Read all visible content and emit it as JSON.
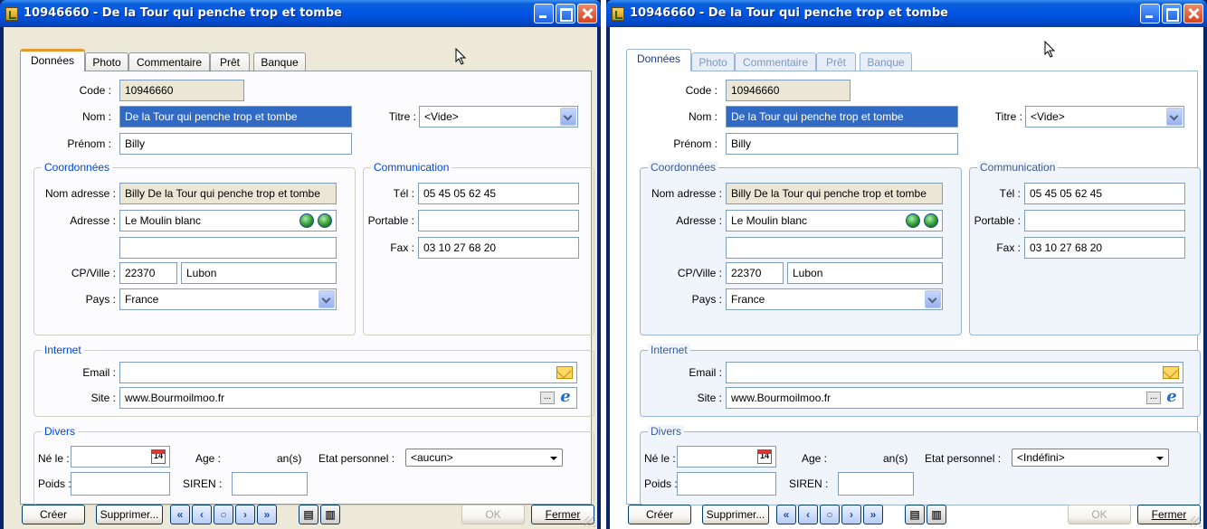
{
  "windows": [
    {
      "id": "left",
      "title": "10946660 - De la Tour qui penche trop et tombe",
      "tabs": [
        "Données",
        "Photo",
        "Commentaire",
        "Prêt",
        "Banque"
      ],
      "fields": {
        "code_label": "Code :",
        "code_value": "10946660",
        "nom_label": "Nom :",
        "nom_value": "De la Tour qui penche trop et tombe",
        "titre_label": "Titre :",
        "titre_value": "<Vide>",
        "prenom_label": "Prénom :",
        "prenom_value": "Billy"
      },
      "coordonnees": {
        "title": "Coordonnées",
        "nom_adresse_label": "Nom adresse :",
        "nom_adresse_value": "Billy De la Tour qui penche trop et tombe",
        "adresse_label": "Adresse :",
        "adresse_value": "Le Moulin blanc",
        "adresse2_value": "",
        "cpville_label": "CP/Ville :",
        "cp_value": "22370",
        "ville_value": "Lubon",
        "pays_label": "Pays :",
        "pays_value": "France"
      },
      "communication": {
        "title": "Communication",
        "tel_label": "Tél :",
        "tel_value": "05 45 05 62 45",
        "portable_label": "Portable :",
        "portable_value": "",
        "fax_label": "Fax :",
        "fax_value": "03 10 27 68 20"
      },
      "internet": {
        "title": "Internet",
        "email_label": "Email :",
        "email_value": "",
        "site_label": "Site :",
        "site_value": "www.Bourmoilmoo.fr",
        "dots": "..."
      },
      "divers": {
        "title": "Divers",
        "ne_le_label": "Né le :",
        "ne_le_value": "",
        "age_label": "Age :",
        "ans_label": "an(s)",
        "etat_label": "Etat personnel :",
        "etat_value": "<aucun>",
        "poids_label": "Poids :",
        "poids_value": "",
        "siren_label": "SIREN :",
        "siren_value": "",
        "calendar_day": "14"
      },
      "buttons": {
        "creer": "Créer",
        "supprimer": "Supprimer...",
        "ok": "OK",
        "fermer": "Fermer"
      }
    },
    {
      "id": "right",
      "title": "10946660 - De la Tour qui penche trop et tombe",
      "tabs": [
        "Données",
        "Photo",
        "Commentaire",
        "Prêt",
        "Banque"
      ],
      "fields": {
        "code_label": "Code :",
        "code_value": "10946660",
        "nom_label": "Nom :",
        "nom_value": "De la Tour qui penche trop et tombe",
        "titre_label": "Titre :",
        "titre_value": "<Vide>",
        "prenom_label": "Prénom :",
        "prenom_value": "Billy"
      },
      "coordonnees": {
        "title": "Coordonnées",
        "nom_adresse_label": "Nom adresse :",
        "nom_adresse_value": "Billy De la Tour qui penche trop et tombe",
        "adresse_label": "Adresse :",
        "adresse_value": "Le Moulin blanc",
        "adresse2_value": "",
        "cpville_label": "CP/Ville :",
        "cp_value": "22370",
        "ville_value": "Lubon",
        "pays_label": "Pays :",
        "pays_value": "France"
      },
      "communication": {
        "title": "Communication",
        "tel_label": "Tél :",
        "tel_value": "05 45 05 62 45",
        "portable_label": "Portable :",
        "portable_value": "",
        "fax_label": "Fax :",
        "fax_value": "03 10 27 68 20"
      },
      "internet": {
        "title": "Internet",
        "email_label": "Email :",
        "email_value": "",
        "site_label": "Site :",
        "site_value": "www.Bourmoilmoo.fr",
        "dots": "..."
      },
      "divers": {
        "title": "Divers",
        "ne_le_label": "Né le :",
        "ne_le_value": "",
        "age_label": "Age :",
        "ans_label": "an(s)",
        "etat_label": "Etat personnel :",
        "etat_value": "<Indéfini>",
        "poids_label": "Poids :",
        "poids_value": "",
        "siren_label": "SIREN :",
        "siren_value": "",
        "calendar_day": "14"
      },
      "buttons": {
        "creer": "Créer",
        "supprimer": "Supprimer...",
        "ok": "OK",
        "fermer": "Fermer"
      }
    }
  ],
  "icons": {
    "app": "app-icon",
    "minimize": "minimize-icon",
    "maximize": "maximize-icon",
    "close": "close-icon",
    "address_search": "address-search-icon",
    "address_map": "address-map-icon",
    "email": "email-icon",
    "browser": "browser-icon",
    "calendar": "calendar-icon",
    "nav": [
      "first-record-icon",
      "previous-record-icon",
      "search-record-icon",
      "next-record-icon",
      "last-record-icon"
    ],
    "print": "print-icon",
    "preview": "preview-icon"
  },
  "colors": {
    "titlebar": "#0055e5",
    "tab_accent": "#e69a2b",
    "group_title": "#0046d5",
    "selection": "#316ac5",
    "readonly_bg": "#ebe6d6"
  }
}
